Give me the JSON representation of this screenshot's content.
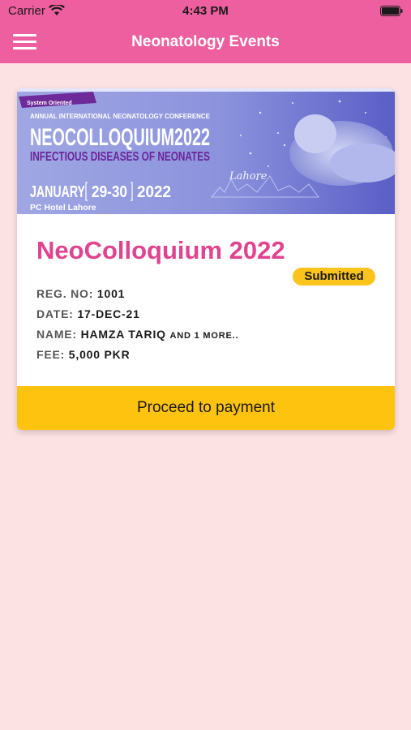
{
  "status_bar": {
    "carrier": "Carrier",
    "time": "4:43 PM"
  },
  "nav": {
    "title": "Neonatology Events"
  },
  "event": {
    "banner": {
      "tag": "System Oriented",
      "line1": "ANNUAL INTERNATIONAL NEONATOLOGY CONFERENCE",
      "line2": "NEOCOLLOQUIUM2022",
      "line3": "INFECTIOUS DISEASES OF NEONATES",
      "dates_month": "JANUARY",
      "dates_days": "29-30",
      "dates_year": "2022",
      "venue": "PC Hotel Lahore",
      "city": "Lahore"
    },
    "title": "NeoColloquium 2022",
    "status": "Submitted",
    "reg_label": "REG. NO:",
    "reg_value": "1001",
    "date_label": "DATE:",
    "date_value": "17-DEC-21",
    "name_label": "NAME:",
    "name_value": "HAMZA TARIQ",
    "name_more": "AND 1 MORE..",
    "fee_label": "FEE:",
    "fee_value": "5,000 PKR",
    "action": "Proceed to payment"
  },
  "colors": {
    "header": "#ed5f9e",
    "background": "#fde2e4",
    "title": "#e0438f",
    "badge": "#fbc41c",
    "button": "#fec30f"
  }
}
